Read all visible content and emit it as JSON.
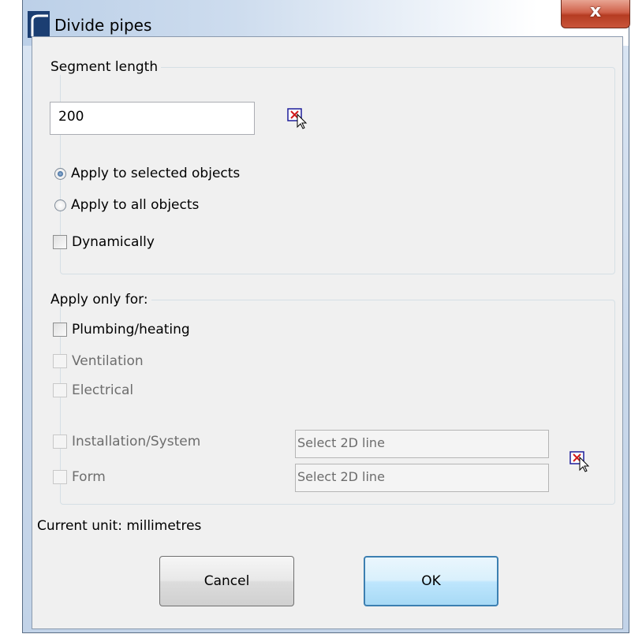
{
  "window": {
    "title": "Divide pipes",
    "close_glyph": "x"
  },
  "segment_group": {
    "label": "Segment length",
    "length_value": "200",
    "pick_icon": "pick-point-icon",
    "options": [
      {
        "label": "Apply to selected objects",
        "selected": true
      },
      {
        "label": "Apply to all objects",
        "selected": false
      }
    ],
    "dynamic_label": "Dynamically",
    "dynamic_checked": false
  },
  "apply_group": {
    "label": "Apply only for:",
    "checks": [
      {
        "label": "Plumbing/heating",
        "enabled": true,
        "checked": false
      },
      {
        "label": "Ventilation",
        "enabled": false,
        "checked": false
      },
      {
        "label": "Electrical",
        "enabled": false,
        "checked": false
      }
    ],
    "installation_label": "Installation/System",
    "form_label": "Form",
    "installation_placeholder": "Select 2D line",
    "form_placeholder": "Select 2D line",
    "pick_icon": "pick-line-icon"
  },
  "status": {
    "unit_text": "Current unit: millimetres"
  },
  "buttons": {
    "cancel": "Cancel",
    "ok": "OK"
  },
  "colors": {
    "titlebar": "#cddcee",
    "close_button": "#c9553a",
    "default_button_border": "#3c7fb1"
  }
}
